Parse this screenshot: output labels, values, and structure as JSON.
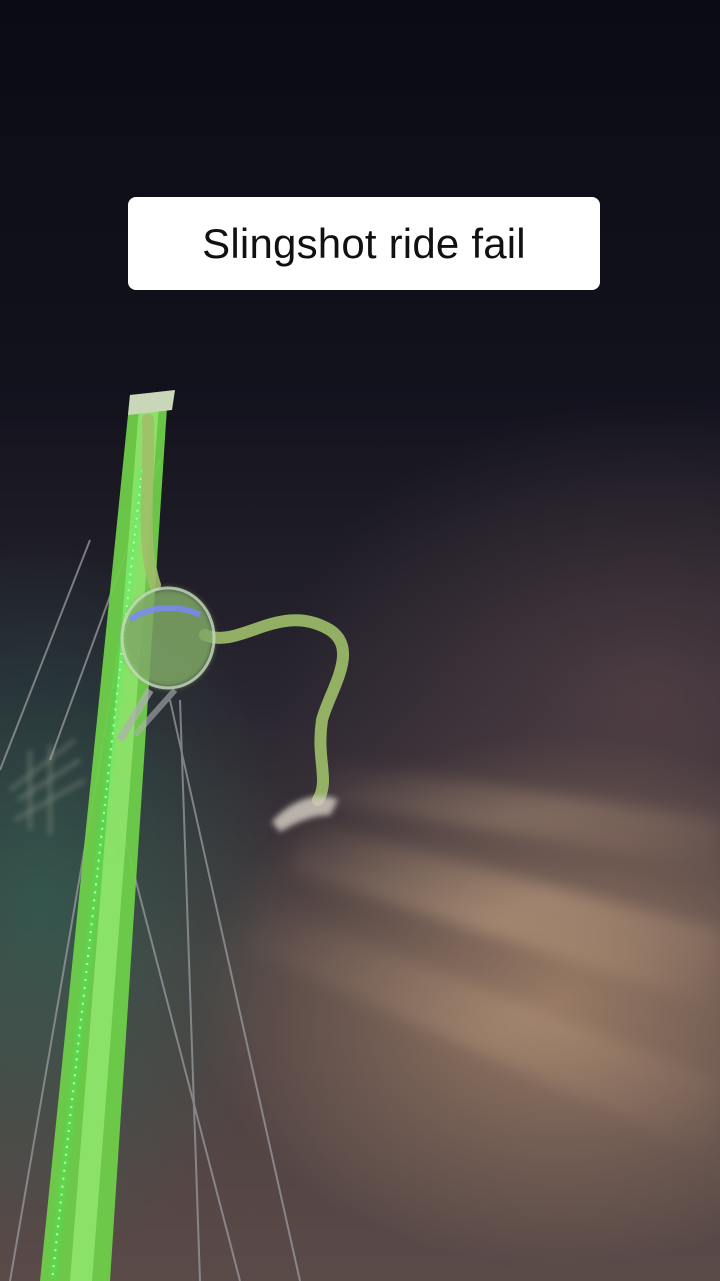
{
  "video": {
    "caption": "Slingshot ride fail"
  },
  "scene": {
    "subject": "slingshot-ride-tower",
    "colors": {
      "tower_green": "#7ee35a",
      "led_green": "#2aff5a",
      "light_beam": "#d9b08a",
      "caption_bg": "#ffffff",
      "caption_text": "#111111"
    }
  }
}
